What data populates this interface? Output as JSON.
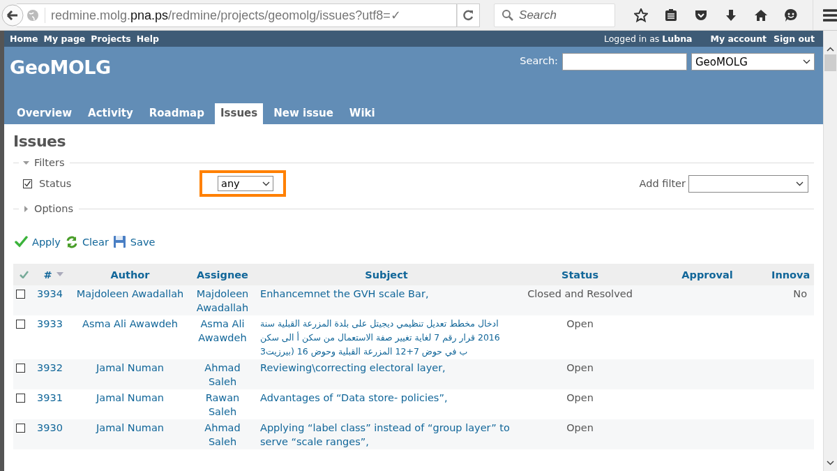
{
  "browser": {
    "url": "redmine.molg.**pna.ps**/redmine/projects/geomolg/issues?utf8=✓",
    "search_placeholder": "Search"
  },
  "top_menu": {
    "items": [
      "Home",
      "My page",
      "Projects",
      "Help"
    ],
    "logged_in": "Logged in as **Lubna**",
    "account_links": [
      "My account",
      "Sign out"
    ]
  },
  "header": {
    "title": "GeoMOLG",
    "search_label": "Search:",
    "project": "GeoMOLG"
  },
  "tabs": [
    {
      "label": "Overview",
      "selected": false
    },
    {
      "label": "Activity",
      "selected": false
    },
    {
      "label": "Roadmap",
      "selected": false
    },
    {
      "label": "Issues",
      "selected": true
    },
    {
      "label": "New issue",
      "selected": false
    },
    {
      "label": "Wiki",
      "selected": false
    }
  ],
  "page_title": "Issues",
  "filters": {
    "legend": "Filters",
    "expanded": true,
    "rows": [
      {
        "label": "Status",
        "checked": true,
        "value": "any",
        "highlighted": true
      }
    ],
    "add_filter_label": "Add filter"
  },
  "options": {
    "legend": "Options",
    "expanded": false
  },
  "actions": [
    {
      "kind": "apply",
      "label": "Apply"
    },
    {
      "kind": "clear",
      "label": "Clear"
    },
    {
      "kind": "save",
      "label": "Save"
    }
  ],
  "table": {
    "columns": [
      {
        "label": "#",
        "sorted": true
      },
      {
        "label": "Author",
        "sorted": false
      },
      {
        "label": "Assignee",
        "sorted": false
      },
      {
        "label": "Subject",
        "sorted": false
      },
      {
        "label": "Status",
        "sorted": false
      },
      {
        "label": "Approval",
        "sorted": false
      },
      {
        "label": "Innova",
        "sorted": false
      }
    ],
    "rows": [
      {
        "selected": false,
        "id": "3934",
        "author": "Majdoleen Awadallah",
        "assignee": "Majdoleen Awadallah",
        "subject": "Enhancemnet the GVH scale Bar,",
        "status": "Closed and Resolved",
        "innova": "No"
      },
      {
        "selected": false,
        "id": "3933",
        "author": "Asma Ali Awawdeh",
        "assignee": "Asma Ali Awawdeh",
        "subject": "ادخال مخطط تعديل تنظيمي ديجيتل على بلدة المزرعة القبلية سنة 2016 قرار رقم 7 لغاية تغيير صفة الاستعمال من سكن أ الى سكن ب في حوض 7+12 المزرعة القبلية وحوض 16 (بيرزيت3",
        "status": "Open"
      },
      {
        "selected": false,
        "id": "3932",
        "author": "Jamal Numan",
        "assignee": "Ahmad Saleh",
        "subject": "Reviewing\\correcting electoral layer,",
        "status": "Open"
      },
      {
        "selected": false,
        "id": "3931",
        "author": "Jamal Numan",
        "assignee": "Rawan Saleh",
        "subject": "Advantages of “Data store- policies”,",
        "status": "Open"
      },
      {
        "selected": false,
        "id": "3930",
        "author": "Jamal Numan",
        "assignee": "Ahmad Saleh",
        "subject": "Applying “label class” instead of “group layer” to serve “scale ranges”,",
        "status": "Open"
      }
    ]
  }
}
